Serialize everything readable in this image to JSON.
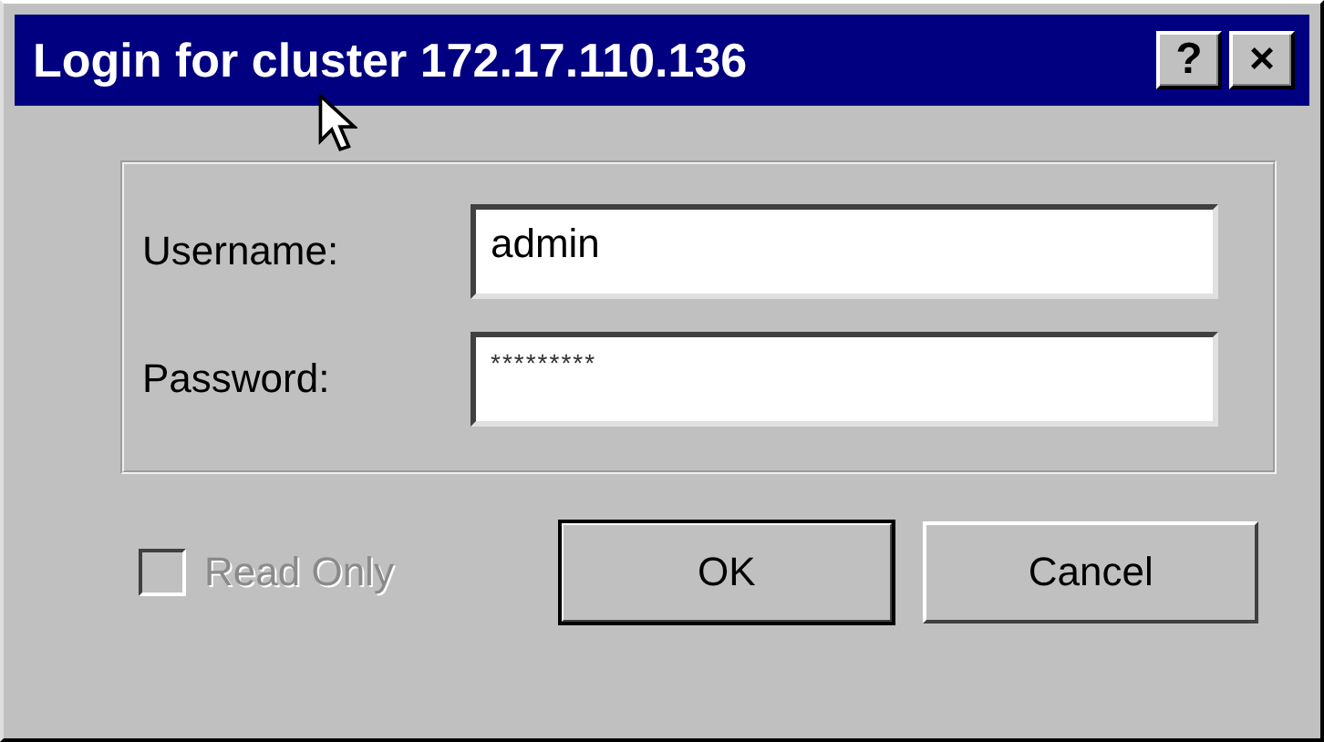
{
  "window": {
    "title": "Login for cluster 172.17.110.136"
  },
  "title_buttons": [
    "?",
    "×"
  ],
  "fields": [
    {
      "label": "Username:",
      "value": "admin"
    },
    {
      "label": "Password:",
      "value": "*********"
    }
  ],
  "read_only": {
    "label": "Read Only",
    "checked": false,
    "disabled": true
  },
  "buttons": [
    {
      "label": "OK",
      "default": true
    },
    {
      "label": "Cancel",
      "default": false
    }
  ]
}
